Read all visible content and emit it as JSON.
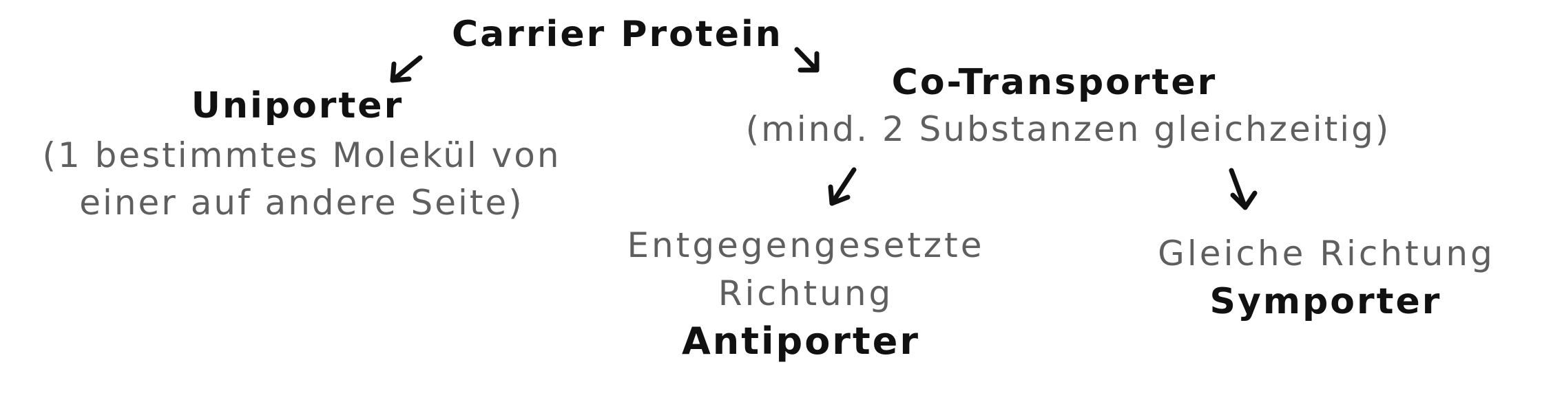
{
  "diagram": {
    "root": "Carrier Protein",
    "uniporter": {
      "title": "Uniporter",
      "description_line1": "(1 bestimmtes Molekül von",
      "description_line2": "einer auf andere Seite)"
    },
    "cotransporter": {
      "title": "Co-Transporter",
      "description": "(mind. 2 Substanzen gleichzeitig)"
    },
    "antiporter": {
      "description_line1": "Entgegengesetzte",
      "description_line2": "Richtung",
      "title": "Antiporter"
    },
    "symporter": {
      "description": "Gleiche Richtung",
      "title": "Symporter"
    }
  },
  "colors": {
    "heading": "#111111",
    "description": "#5f5f5f",
    "arrow": "#111111",
    "background": "#ffffff"
  }
}
